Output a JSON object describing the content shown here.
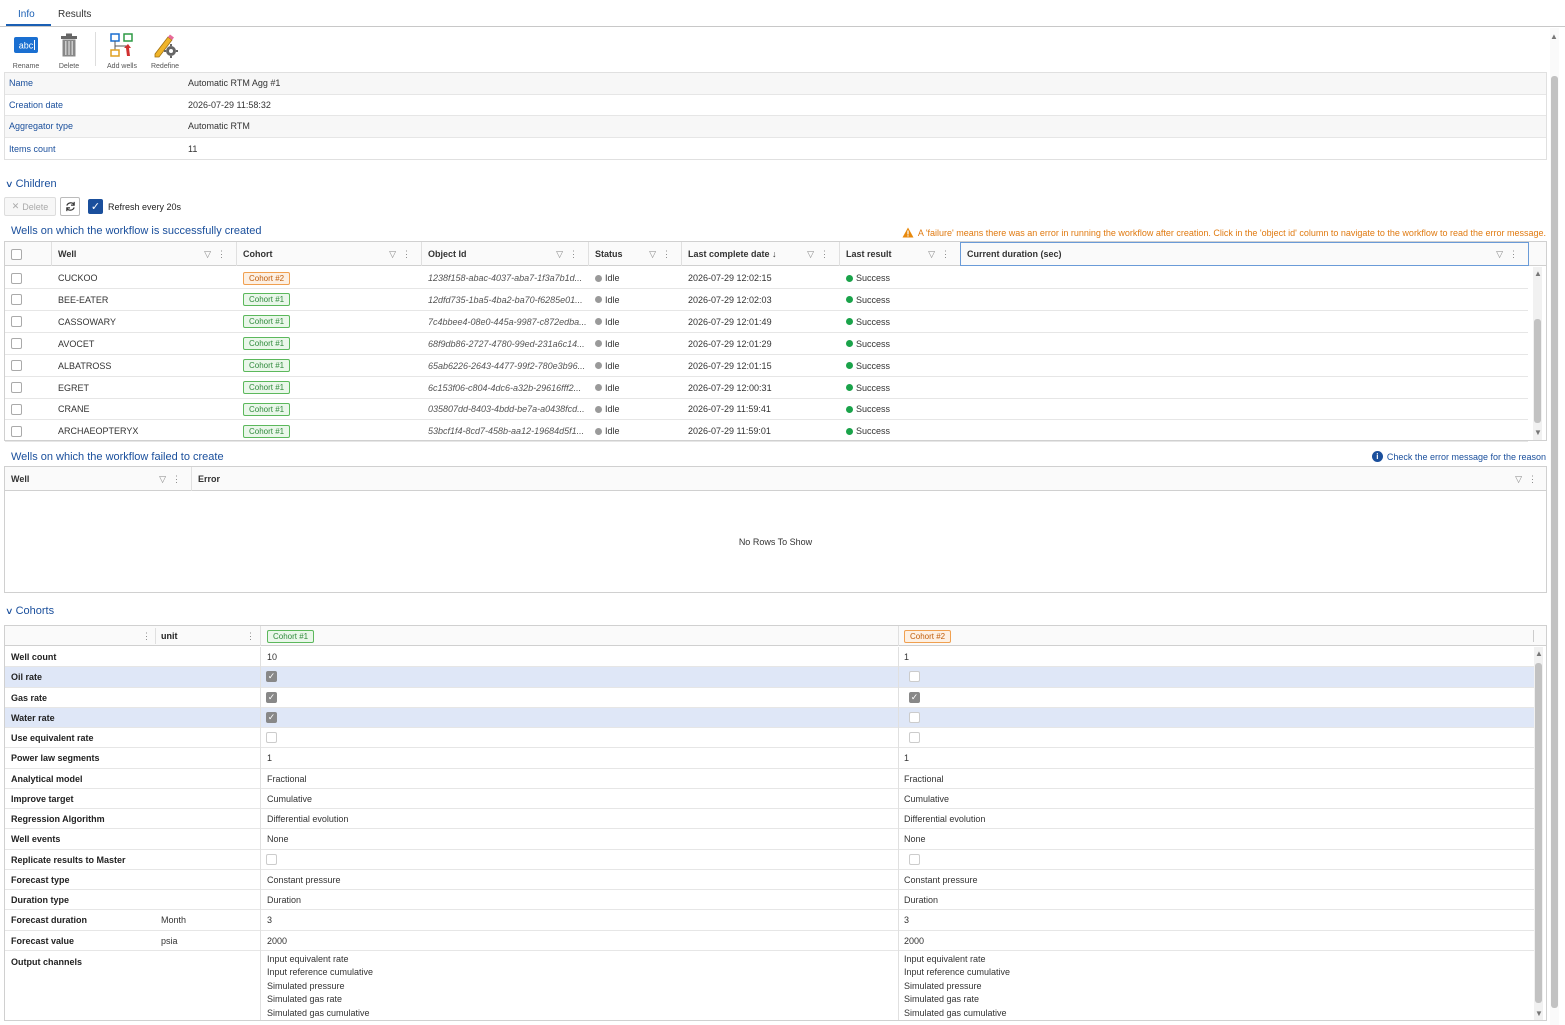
{
  "tabs": [
    {
      "label": "Info"
    },
    {
      "label": "Results"
    }
  ],
  "toolbar": {
    "rename": "Rename",
    "delete": "Delete",
    "add_wells": "Add wells",
    "redefine": "Redefine"
  },
  "info": {
    "rows": [
      {
        "key": "Name",
        "value": "Automatic RTM Agg #1"
      },
      {
        "key": "Creation date",
        "value": "2026-07-29 11:58:32"
      },
      {
        "key": "Aggregator type",
        "value": "Automatic RTM"
      },
      {
        "key": "Items count",
        "value": "11"
      }
    ]
  },
  "children": {
    "title": "Children",
    "delete_label": "Delete",
    "refresh_label": "Refresh every 20s",
    "success_title": "Wells on which the workflow is successfully created",
    "warning": "A 'failure' means there was an error in running the workflow after creation. Click in the 'object id' column to navigate to the workflow to read the error message.",
    "columns": [
      "Well",
      "Cohort",
      "Object Id",
      "Status",
      "Last complete date",
      "Last result",
      "Current duration (sec)"
    ],
    "rows": [
      {
        "well": "CUCKOO",
        "cohort": "Cohort #2",
        "cohort_kind": "2",
        "object_id": "1238f158-abac-4037-aba7-1f3a7b1d...",
        "status": "Idle",
        "date": "2026-07-29 12:02:15",
        "result": "Success"
      },
      {
        "well": "BEE-EATER",
        "cohort": "Cohort #1",
        "cohort_kind": "1",
        "object_id": "12dfd735-1ba5-4ba2-ba70-f6285e01...",
        "status": "Idle",
        "date": "2026-07-29 12:02:03",
        "result": "Success"
      },
      {
        "well": "CASSOWARY",
        "cohort": "Cohort #1",
        "cohort_kind": "1",
        "object_id": "7c4bbee4-08e0-445a-9987-c872edba...",
        "status": "Idle",
        "date": "2026-07-29 12:01:49",
        "result": "Success"
      },
      {
        "well": "AVOCET",
        "cohort": "Cohort #1",
        "cohort_kind": "1",
        "object_id": "68f9db86-2727-4780-99ed-231a6c14...",
        "status": "Idle",
        "date": "2026-07-29 12:01:29",
        "result": "Success"
      },
      {
        "well": "ALBATROSS",
        "cohort": "Cohort #1",
        "cohort_kind": "1",
        "object_id": "65ab6226-2643-4477-99f2-780e3b96...",
        "status": "Idle",
        "date": "2026-07-29 12:01:15",
        "result": "Success"
      },
      {
        "well": "EGRET",
        "cohort": "Cohort #1",
        "cohort_kind": "1",
        "object_id": "6c153f06-c804-4dc6-a32b-29616fff2...",
        "status": "Idle",
        "date": "2026-07-29 12:00:31",
        "result": "Success"
      },
      {
        "well": "CRANE",
        "cohort": "Cohort #1",
        "cohort_kind": "1",
        "object_id": "035807dd-8403-4bdd-be7a-a0438fcd...",
        "status": "Idle",
        "date": "2026-07-29 11:59:41",
        "result": "Success"
      },
      {
        "well": "ARCHAEOPTERYX",
        "cohort": "Cohort #1",
        "cohort_kind": "1",
        "object_id": "53bcf1f4-8cd7-458b-aa12-19684d5f1...",
        "status": "Idle",
        "date": "2026-07-29 11:59:01",
        "result": "Success"
      }
    ],
    "failed_title": "Wells on which the workflow failed to create",
    "failed_note": "Check the error message for the reason",
    "failed_columns": [
      "Well",
      "Error"
    ],
    "no_rows": "No Rows To Show"
  },
  "cohorts": {
    "title": "Cohorts",
    "unit_header": "unit",
    "cohort1": "Cohort #1",
    "cohort2": "Cohort #2",
    "rows": [
      {
        "key": "Well count",
        "unit": "",
        "v1": "10",
        "v2": "1"
      },
      {
        "key": "Oil rate",
        "unit": "",
        "c1": true,
        "c2": false,
        "hl": true
      },
      {
        "key": "Gas rate",
        "unit": "",
        "c1": true,
        "c2": true
      },
      {
        "key": "Water rate",
        "unit": "",
        "c1": true,
        "c2": false,
        "hl": true
      },
      {
        "key": "Use equivalent rate",
        "unit": "",
        "c1": false,
        "c2": false
      },
      {
        "key": "Power law segments",
        "unit": "",
        "v1": "1",
        "v2": "1"
      },
      {
        "key": "Analytical model",
        "unit": "",
        "v1": "Fractional",
        "v2": "Fractional"
      },
      {
        "key": "Improve target",
        "unit": "",
        "v1": "Cumulative",
        "v2": "Cumulative"
      },
      {
        "key": "Regression Algorithm",
        "unit": "",
        "v1": "Differential evolution",
        "v2": "Differential evolution"
      },
      {
        "key": "Well events",
        "unit": "",
        "v1": "None",
        "v2": "None"
      },
      {
        "key": "Replicate results to Master",
        "unit": "",
        "c1": false,
        "c2": false
      },
      {
        "key": "Forecast type",
        "unit": "",
        "v1": "Constant pressure",
        "v2": "Constant pressure"
      },
      {
        "key": "Duration type",
        "unit": "",
        "v1": "Duration",
        "v2": "Duration"
      },
      {
        "key": "Forecast duration",
        "unit": "Month",
        "v1": "3",
        "v2": "3"
      },
      {
        "key": "Forecast value",
        "unit": "psia",
        "v1": "2000",
        "v2": "2000"
      }
    ],
    "output_channels_key": "Output channels",
    "output_channels": [
      "Input equivalent rate",
      "Input reference cumulative",
      "Simulated pressure",
      "Simulated gas rate",
      "Simulated gas cumulative"
    ]
  }
}
